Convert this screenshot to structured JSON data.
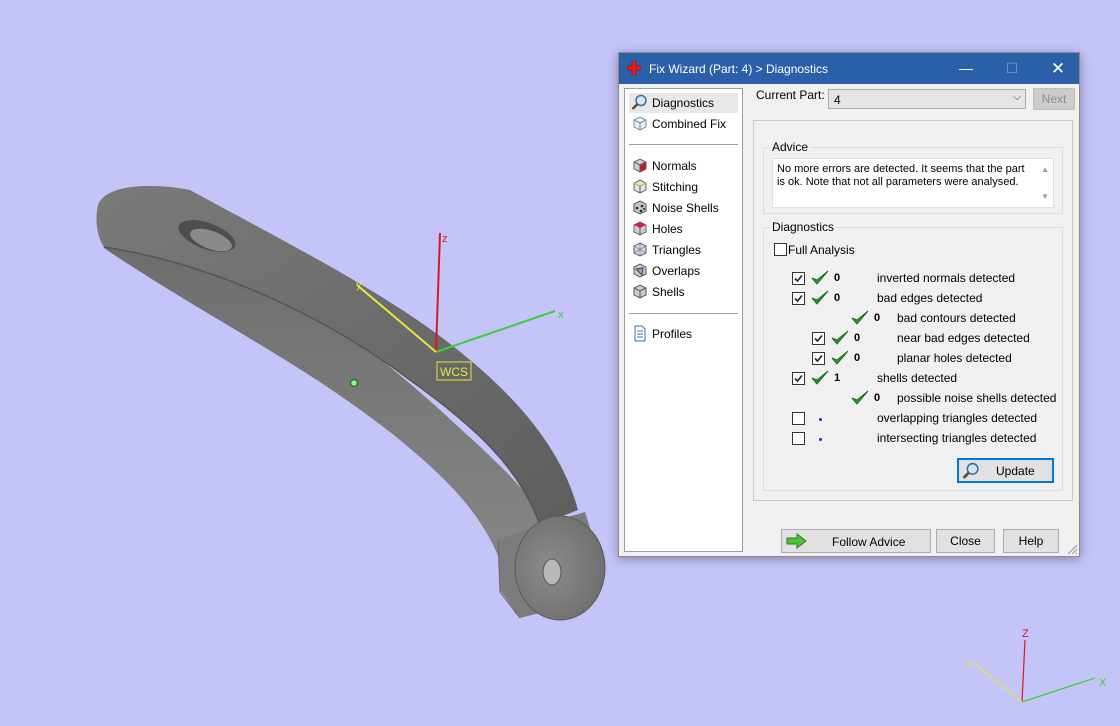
{
  "viewport": {
    "wcs_label": "WCS",
    "axis_main": {
      "x": "x",
      "y": "y",
      "z": "z"
    },
    "axis_corner": {
      "x": "X",
      "y": "Y",
      "z": "Z"
    }
  },
  "dialog": {
    "title": "Fix Wizard (Part: 4) > Diagnostics",
    "minimize_glyph": "—",
    "maximize_glyph": "☐",
    "close_glyph": "✕",
    "nav": {
      "diagnostics": "Diagnostics",
      "combined_fix": "Combined Fix",
      "normals": "Normals",
      "stitching": "Stitching",
      "noise_shells": "Noise Shells",
      "holes": "Holes",
      "triangles": "Triangles",
      "overlaps": "Overlaps",
      "shells": "Shells",
      "profiles": "Profiles"
    },
    "current_part_label": "Current Part:",
    "current_part_value": "4",
    "next_button": "Next",
    "advice": {
      "title": "Advice",
      "text": "No more errors are detected. It seems that the part is ok. Note that not all parameters were analysed."
    },
    "diagnostics": {
      "title": "Diagnostics",
      "full_analysis_label": "Full Analysis",
      "full_analysis_checked": false,
      "rows": [
        {
          "checked": true,
          "status": "ok",
          "count": "0",
          "label": "inverted normals detected"
        },
        {
          "checked": true,
          "status": "ok",
          "count": "0",
          "label": "bad edges detected"
        },
        {
          "status": "ok",
          "count": "0",
          "label": "bad contours detected"
        },
        {
          "checked": true,
          "status": "ok",
          "count": "0",
          "label": "near bad edges detected"
        },
        {
          "checked": true,
          "status": "ok",
          "count": "0",
          "label": "planar holes detected"
        },
        {
          "checked": true,
          "status": "ok",
          "count": "1",
          "label": "shells detected"
        },
        {
          "status": "ok",
          "count": "0",
          "label": "possible noise shells detected"
        },
        {
          "checked": false,
          "status": "pending",
          "count": "",
          "label": "overlapping triangles detected"
        },
        {
          "checked": false,
          "status": "pending",
          "count": "",
          "label": "intersecting triangles detected"
        }
      ]
    },
    "update_button": "Update",
    "follow_advice_button": "Follow Advice",
    "close_button": "Close",
    "help_button": "Help"
  },
  "colors": {
    "background": "#c4c4f9",
    "titlebar": "#2b5fa8",
    "ok_check": "#2a9b2a",
    "axis_x": "#3ccf3c",
    "axis_y": "#e6e63c",
    "axis_z": "#d41c1c"
  }
}
